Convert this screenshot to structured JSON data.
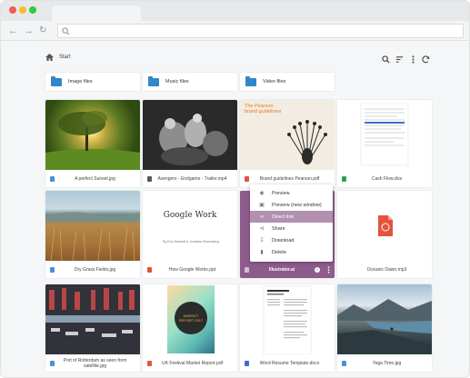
{
  "breadcrumb": {
    "label": "Start"
  },
  "folders": [
    {
      "name": "Image files"
    },
    {
      "name": "Music files"
    },
    {
      "name": "Video files"
    }
  ],
  "files": [
    {
      "name": "A perfect Sunset.jpg",
      "type": "image"
    },
    {
      "name": "Avengers - Endgame - Trailer.mp4",
      "type": "video"
    },
    {
      "name": "Brand guidelines Pearson.pdf",
      "type": "pdf"
    },
    {
      "name": "Cash Flow.xlsx",
      "type": "sheet"
    },
    {
      "name": "Dry Grass Fields.jpg",
      "type": "image"
    },
    {
      "name": "How Google Works.ppt",
      "type": "slides"
    },
    {
      "name": "Illustrator.ai",
      "type": "illustrator"
    },
    {
      "name": "Oceanic Dawn.mp3",
      "type": "audio"
    },
    {
      "name": "Port of Rotterdam as seen from satellite.jpg",
      "type": "image"
    },
    {
      "name": "UK Festival Market Report.pdf",
      "type": "pdf"
    },
    {
      "name": "Word Resume Template.docx",
      "type": "doc"
    },
    {
      "name": "Yoga Time.jpg",
      "type": "image"
    }
  ],
  "thumbnails": {
    "pearson_title": "The Pearson\nbrand guidelines",
    "google_work_text": "Google Work",
    "google_work_sub": "By Eric Schmidt & Jonathan Rosenberg",
    "market_report_text": "MARKET REPORT 2017"
  },
  "context_menu": [
    {
      "label": "Preview",
      "icon": "eye-icon",
      "highlighted": false
    },
    {
      "label": "Preview (new window)",
      "icon": "window-icon",
      "highlighted": false
    },
    {
      "label": "Direct link",
      "icon": "link-icon",
      "highlighted": true
    },
    {
      "label": "Share",
      "icon": "share-icon",
      "highlighted": false
    },
    {
      "label": "Download",
      "icon": "download-icon",
      "highlighted": false
    },
    {
      "label": "Delete",
      "icon": "trash-icon",
      "highlighted": false
    }
  ],
  "colors": {
    "accent_selected": "#8e5b8d",
    "menu_highlight": "#b190b0",
    "folder": "#2f88c7",
    "pdf": "#e5533d",
    "sheet": "#2e9d5b",
    "doc": "#3d6fc9"
  }
}
